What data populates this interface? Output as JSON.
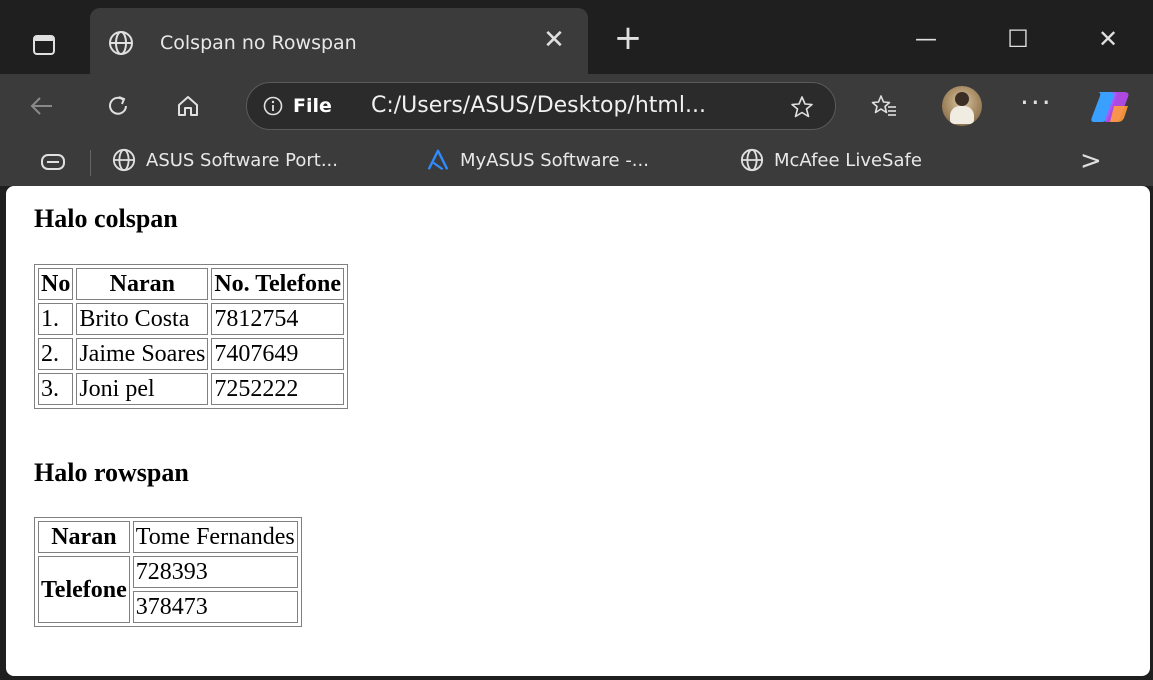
{
  "browser": {
    "tab_title": "Colspan no Rowspan",
    "close_tab": "✕",
    "new_tab": "+",
    "window_minimize": "—",
    "window_maximize": "☐",
    "window_close": "✕",
    "address_file_label": "File",
    "address_url": "C:/Users/ASUS/Desktop/html...",
    "more_label": "···",
    "bookmarks": [
      {
        "label": "ASUS Software Port...",
        "icon": "globe-icon"
      },
      {
        "label": "MyASUS Software -...",
        "icon": "myasus-icon"
      },
      {
        "label": "McAfee LiveSafe",
        "icon": "globe-icon"
      }
    ],
    "bookmarks_more": ">"
  },
  "page": {
    "colspan_heading": "Halo colspan",
    "colspan_table": {
      "headers": [
        "No",
        "Naran",
        "No. Telefone"
      ],
      "rows": [
        [
          "1.",
          "Brito Costa",
          "7812754"
        ],
        [
          "2.",
          "Jaime Soares",
          "7407649"
        ],
        [
          "3.",
          "Joni pel",
          "7252222"
        ]
      ]
    },
    "rowspan_heading": "Halo rowspan",
    "rowspan_table": {
      "name_header": "Naran",
      "name_value": "Tome Fernandes",
      "phone_header": "Telefone",
      "phones": [
        "728393",
        "378473"
      ]
    }
  }
}
